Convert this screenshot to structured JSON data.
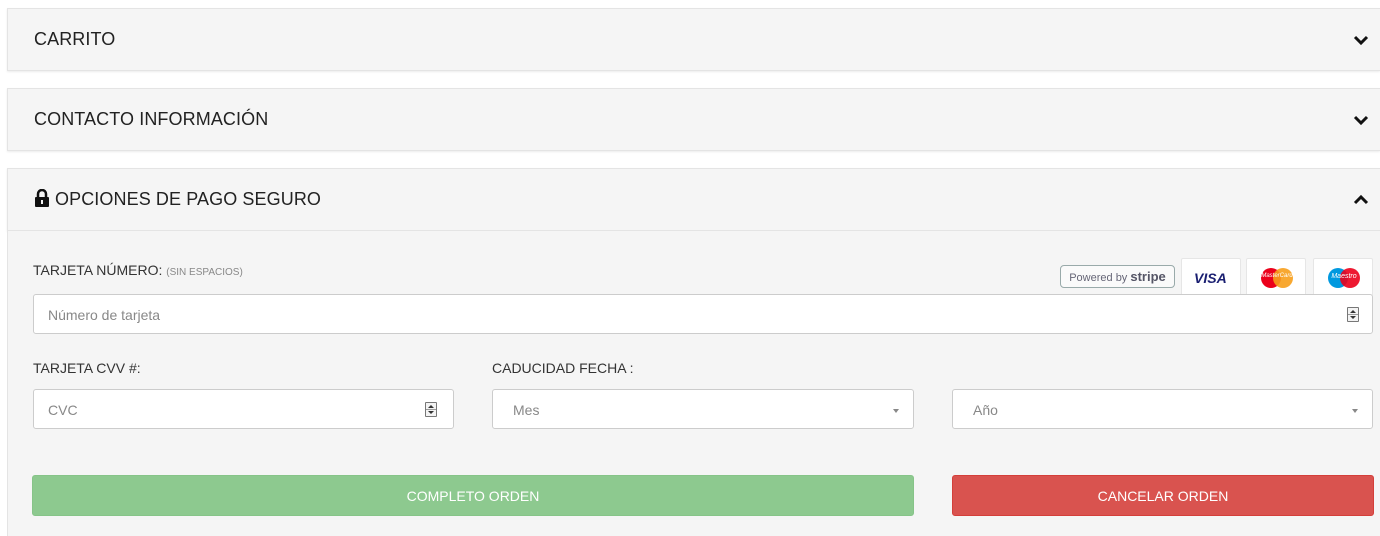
{
  "panels": {
    "cart": {
      "title": "CARRITO"
    },
    "contact": {
      "title": "CONTACTO INFORMACIÓN"
    },
    "payment": {
      "title": "OPCIONES DE PAGO SEGURO"
    }
  },
  "payment_form": {
    "card_number_label": "TARJETA NÚMERO:",
    "card_number_hint": "(SIN ESPACIOS)",
    "card_number_placeholder": "Número de tarjeta",
    "cvv_label": "TARJETA CVV #:",
    "cvv_placeholder": "CVC",
    "expiry_label": "CADUCIDAD FECHA :",
    "month_placeholder": "Mes",
    "year_placeholder": "Año",
    "submit_label": "COMPLETO ORDEN",
    "cancel_label": "CANCELAR ORDEN"
  },
  "badges": {
    "powered_by": "Powered by",
    "stripe": "stripe",
    "visa": "VISA",
    "mastercard": "MasterCard",
    "maestro": "Maestro"
  },
  "colors": {
    "submit": "#8dc98f",
    "cancel": "#d9534f",
    "visa_blue": "#1a1f71",
    "mc_red": "#eb001b",
    "mc_orange": "#f79e1b",
    "maestro_blue": "#0099df"
  },
  "icons": {
    "collapsed": "chevron-down-icon",
    "expanded": "chevron-up-icon",
    "secure": "lock-icon"
  }
}
